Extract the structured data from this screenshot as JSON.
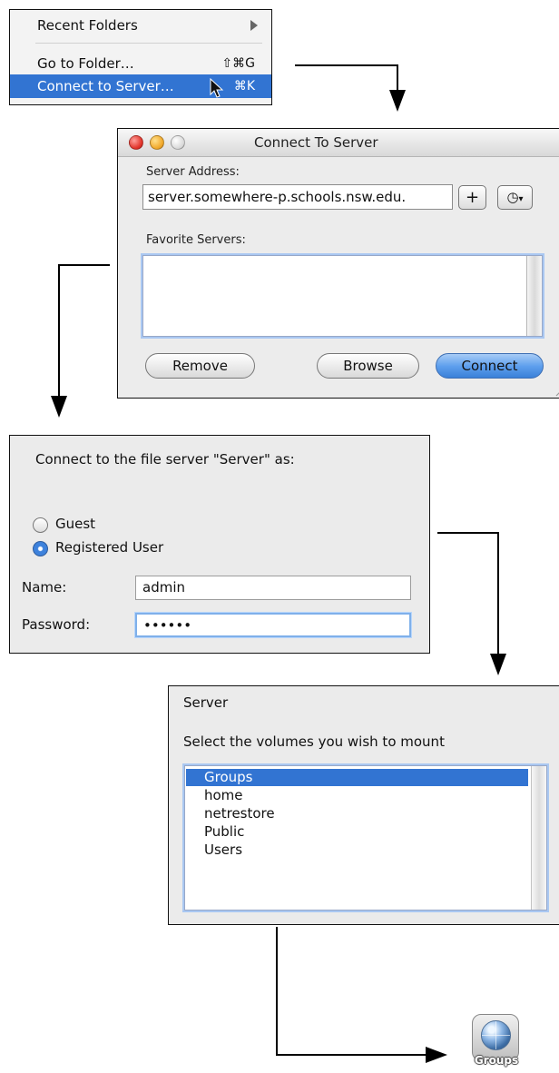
{
  "go_menu": {
    "recent_folders_label": "Recent Folders",
    "go_to_folder_label": "Go to Folder…",
    "go_to_folder_shortcut": "⇧⌘G",
    "connect_to_server_label": "Connect to Server…",
    "connect_to_server_shortcut": "⌘K"
  },
  "connect_window": {
    "title": "Connect To Server",
    "server_address_label": "Server Address:",
    "server_address_value": "server.somewhere-p.schools.nsw.edu.",
    "add_button_label": "+",
    "recent_button_label": "◷",
    "favorite_servers_label": "Favorite Servers:",
    "remove_button": "Remove",
    "browse_button": "Browse",
    "connect_button": "Connect"
  },
  "auth_dialog": {
    "prompt": "Connect to the file server \"Server\" as:",
    "guest_label": "Guest",
    "registered_label": "Registered User",
    "name_label": "Name:",
    "name_value": "admin",
    "password_label": "Password:",
    "password_value": "••••••"
  },
  "volume_picker": {
    "server_title": "Server",
    "instruction": "Select the volumes you wish to mount",
    "volumes": [
      "Groups",
      "home",
      "netrestore",
      "Public",
      "Users"
    ]
  },
  "desktop_volume": {
    "label": "Groups"
  }
}
